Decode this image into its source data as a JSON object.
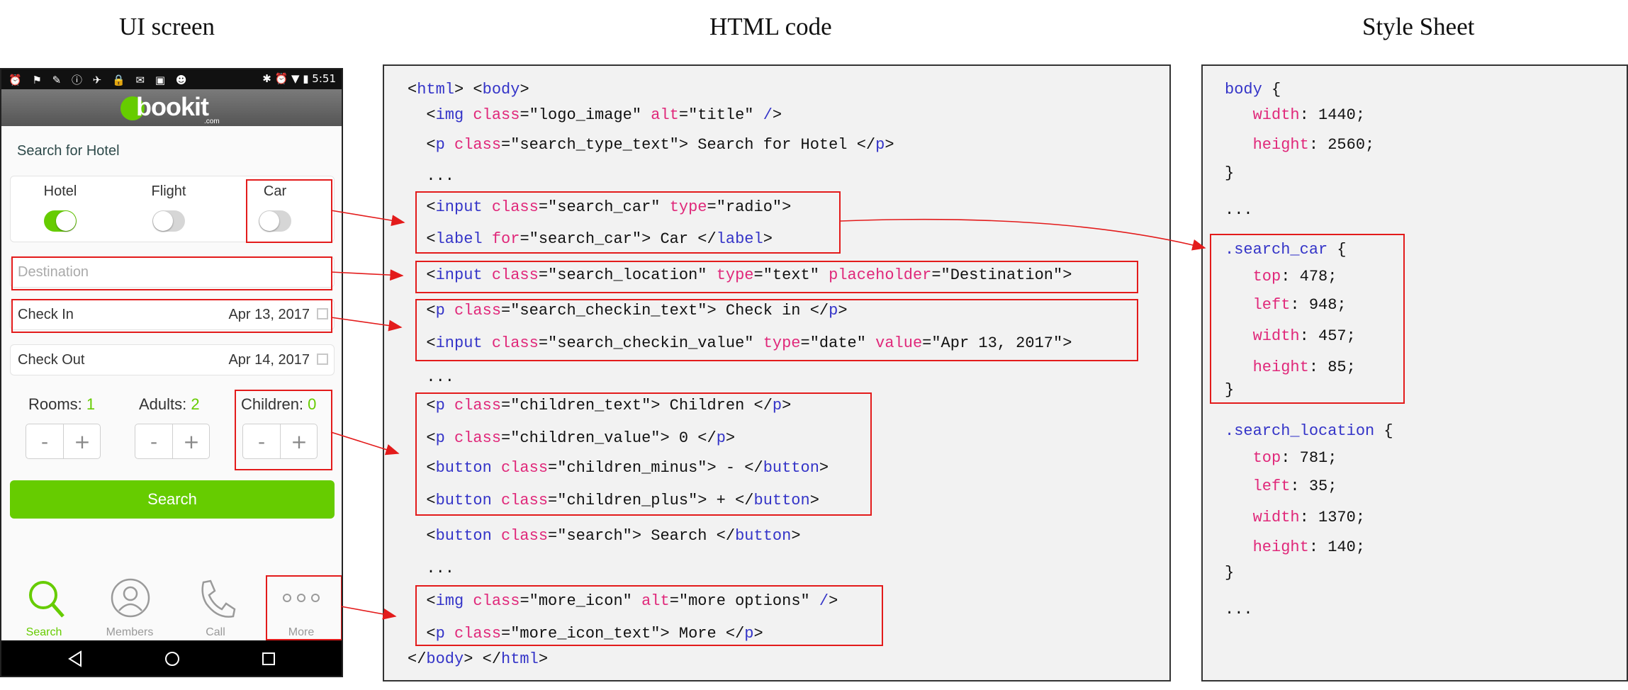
{
  "titles": {
    "ui": "UI screen",
    "html": "HTML code",
    "css": "Style Sheet"
  },
  "phone": {
    "status_icons": "⏰ ⚑ ✎ ⓘ ✈ 🔒 ✉ ▣ ☻",
    "status_right": "✱ ⏰ ▼ ▮ 5:51",
    "logo_text": "bookit",
    "logo_sub": ".com",
    "search_title": "Search for Hotel",
    "types": [
      {
        "label": "Hotel",
        "on": true
      },
      {
        "label": "Flight",
        "on": false
      },
      {
        "label": "Car",
        "on": false
      }
    ],
    "destination_placeholder": "Destination",
    "checkin": {
      "label": "Check In",
      "value": "Apr 13, 2017"
    },
    "checkout": {
      "label": "Check Out",
      "value": "Apr 14, 2017"
    },
    "counters": [
      {
        "label": "Rooms: ",
        "value": "1"
      },
      {
        "label": "Adults: ",
        "value": "2"
      },
      {
        "label": "Children: ",
        "value": "0"
      }
    ],
    "minus": "-",
    "plus": "+",
    "search_button": "Search",
    "tabs": [
      {
        "label": "Search",
        "icon": "search-icon"
      },
      {
        "label": "Members",
        "icon": "person-icon"
      },
      {
        "label": "Call",
        "icon": "phone-icon"
      },
      {
        "label": "More",
        "icon": "more-dots-icon"
      }
    ],
    "nav_icons": [
      "back-icon",
      "home-icon",
      "recents-icon"
    ],
    "accent": "#66cc00"
  },
  "html_code": [
    [
      [
        "p",
        "<"
      ],
      [
        "t",
        "html"
      ],
      [
        "p",
        "> <"
      ],
      [
        "t",
        "body"
      ],
      [
        "p",
        ">"
      ]
    ],
    [
      [
        "p",
        "  <"
      ],
      [
        "t",
        "img"
      ],
      [
        "p",
        " "
      ],
      [
        "a",
        "class"
      ],
      [
        "p",
        "=\"logo_image\" "
      ],
      [
        "a",
        "alt"
      ],
      [
        "p",
        "=\"title\" "
      ],
      [
        "t",
        "/"
      ],
      [
        "p",
        ">"
      ]
    ],
    [
      [
        "p",
        "  <"
      ],
      [
        "t",
        "p"
      ],
      [
        "p",
        " "
      ],
      [
        "a",
        "class"
      ],
      [
        "p",
        "=\"search_type_text\"> Search for Hotel </"
      ],
      [
        "t",
        "p"
      ],
      [
        "p",
        ">"
      ]
    ],
    [
      [
        "p",
        "  ..."
      ]
    ],
    [
      [
        "p",
        "  <"
      ],
      [
        "t",
        "input"
      ],
      [
        "p",
        " "
      ],
      [
        "a",
        "class"
      ],
      [
        "p",
        "=\"search_car\" "
      ],
      [
        "a",
        "type"
      ],
      [
        "p",
        "=\"radio\">"
      ]
    ],
    [
      [
        "p",
        "  <"
      ],
      [
        "t",
        "label"
      ],
      [
        "p",
        " "
      ],
      [
        "a",
        "for"
      ],
      [
        "p",
        "=\"search_car\"> Car </"
      ],
      [
        "t",
        "label"
      ],
      [
        "p",
        ">"
      ]
    ],
    [
      [
        "p",
        "  <"
      ],
      [
        "t",
        "input"
      ],
      [
        "p",
        " "
      ],
      [
        "a",
        "class"
      ],
      [
        "p",
        "=\"search_location\" "
      ],
      [
        "a",
        "type"
      ],
      [
        "p",
        "=\"text\" "
      ],
      [
        "a",
        "placeholder"
      ],
      [
        "p",
        "=\"Destination\">"
      ]
    ],
    [
      [
        "p",
        "  <"
      ],
      [
        "t",
        "p"
      ],
      [
        "p",
        " "
      ],
      [
        "a",
        "class"
      ],
      [
        "p",
        "=\"search_checkin_text\"> Check in </"
      ],
      [
        "t",
        "p"
      ],
      [
        "p",
        ">"
      ]
    ],
    [
      [
        "p",
        "  <"
      ],
      [
        "t",
        "input"
      ],
      [
        "p",
        " "
      ],
      [
        "a",
        "class"
      ],
      [
        "p",
        "=\"search_checkin_value\" "
      ],
      [
        "a",
        "type"
      ],
      [
        "p",
        "=\"date\" "
      ],
      [
        "a",
        "value"
      ],
      [
        "p",
        "=\"Apr 13, 2017\">"
      ]
    ],
    [
      [
        "p",
        "  ..."
      ]
    ],
    [
      [
        "p",
        "  <"
      ],
      [
        "t",
        "p"
      ],
      [
        "p",
        " "
      ],
      [
        "a",
        "class"
      ],
      [
        "p",
        "=\"children_text\"> Children </"
      ],
      [
        "t",
        "p"
      ],
      [
        "p",
        ">"
      ]
    ],
    [
      [
        "p",
        "  <"
      ],
      [
        "t",
        "p"
      ],
      [
        "p",
        " "
      ],
      [
        "a",
        "class"
      ],
      [
        "p",
        "=\"children_value\"> 0 </"
      ],
      [
        "t",
        "p"
      ],
      [
        "p",
        ">"
      ]
    ],
    [
      [
        "p",
        "  <"
      ],
      [
        "t",
        "button"
      ],
      [
        "p",
        " "
      ],
      [
        "a",
        "class"
      ],
      [
        "p",
        "=\"children_minus\"> - </"
      ],
      [
        "t",
        "button"
      ],
      [
        "p",
        ">"
      ]
    ],
    [
      [
        "p",
        "  <"
      ],
      [
        "t",
        "button"
      ],
      [
        "p",
        " "
      ],
      [
        "a",
        "class"
      ],
      [
        "p",
        "=\"children_plus\"> + </"
      ],
      [
        "t",
        "button"
      ],
      [
        "p",
        ">"
      ]
    ],
    [
      [
        "p",
        "  <"
      ],
      [
        "t",
        "button"
      ],
      [
        "p",
        " "
      ],
      [
        "a",
        "class"
      ],
      [
        "p",
        "=\"search\"> Search </"
      ],
      [
        "t",
        "button"
      ],
      [
        "p",
        ">"
      ]
    ],
    [
      [
        "p",
        "  ..."
      ]
    ],
    [
      [
        "p",
        "  <"
      ],
      [
        "t",
        "img"
      ],
      [
        "p",
        " "
      ],
      [
        "a",
        "class"
      ],
      [
        "p",
        "=\"more_icon\" "
      ],
      [
        "a",
        "alt"
      ],
      [
        "p",
        "=\"more options\" "
      ],
      [
        "t",
        "/"
      ],
      [
        "p",
        ">"
      ]
    ],
    [
      [
        "p",
        "  <"
      ],
      [
        "t",
        "p"
      ],
      [
        "p",
        " "
      ],
      [
        "a",
        "class"
      ],
      [
        "p",
        "=\"more_icon_text\"> More </"
      ],
      [
        "t",
        "p"
      ],
      [
        "p",
        ">"
      ]
    ],
    [
      [
        "p",
        "</"
      ],
      [
        "t",
        "body"
      ],
      [
        "p",
        "> </"
      ],
      [
        "t",
        "html"
      ],
      [
        "p",
        ">"
      ]
    ]
  ],
  "css_code": [
    [
      [
        "t",
        "body"
      ],
      [
        "p",
        " {"
      ]
    ],
    [
      [
        "p",
        "   "
      ],
      [
        "a",
        "width"
      ],
      [
        "p",
        ": 1440;"
      ]
    ],
    [
      [
        "p",
        "   "
      ],
      [
        "a",
        "height"
      ],
      [
        "p",
        ": 2560;"
      ]
    ],
    [
      [
        "p",
        "}"
      ]
    ],
    [
      [
        "p",
        "..."
      ]
    ],
    [
      [
        "t",
        ".search_car"
      ],
      [
        "p",
        " {"
      ]
    ],
    [
      [
        "p",
        "   "
      ],
      [
        "a",
        "top"
      ],
      [
        "p",
        ": 478;"
      ]
    ],
    [
      [
        "p",
        "   "
      ],
      [
        "a",
        "left"
      ],
      [
        "p",
        ": 948;"
      ]
    ],
    [
      [
        "p",
        "   "
      ],
      [
        "a",
        "width"
      ],
      [
        "p",
        ": 457;"
      ]
    ],
    [
      [
        "p",
        "   "
      ],
      [
        "a",
        "height"
      ],
      [
        "p",
        ": 85;"
      ]
    ],
    [
      [
        "p",
        "}"
      ]
    ],
    [
      [
        "t",
        ".search_location"
      ],
      [
        "p",
        " {"
      ]
    ],
    [
      [
        "p",
        "   "
      ],
      [
        "a",
        "top"
      ],
      [
        "p",
        ": 781;"
      ]
    ],
    [
      [
        "p",
        "   "
      ],
      [
        "a",
        "left"
      ],
      [
        "p",
        ": 35;"
      ]
    ],
    [
      [
        "p",
        "   "
      ],
      [
        "a",
        "width"
      ],
      [
        "p",
        ": 1370;"
      ]
    ],
    [
      [
        "p",
        "   "
      ],
      [
        "a",
        "height"
      ],
      [
        "p",
        ": 140;"
      ]
    ],
    [
      [
        "p",
        "}"
      ]
    ],
    [
      [
        "p",
        "..."
      ]
    ]
  ]
}
